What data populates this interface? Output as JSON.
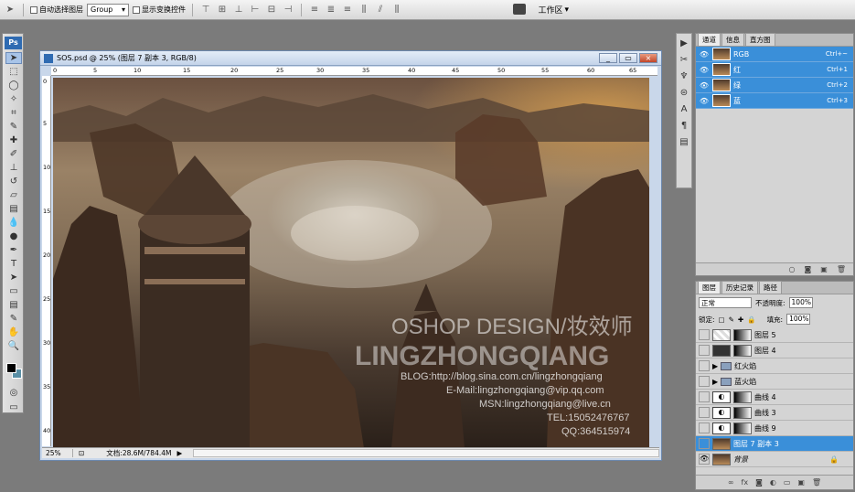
{
  "options_bar": {
    "auto_select_label": "自动选择图层",
    "auto_select_value": "Group",
    "show_transform_label": "显示变换控件",
    "workspace_label": "工作区"
  },
  "toolbox": {
    "logo": "Ps"
  },
  "document": {
    "title": "SOS.psd @ 25% (图层 7 副本 3, RGB/8)",
    "zoom": "25%",
    "doc_info": "文档:28.6M/784.4M",
    "ruler_h": [
      "0",
      "5",
      "10",
      "15",
      "20",
      "25",
      "30",
      "35",
      "40",
      "45",
      "50",
      "55",
      "60",
      "65"
    ],
    "ruler_v": [
      "0",
      "5",
      "10",
      "15",
      "20",
      "25",
      "30",
      "35",
      "40"
    ],
    "watermark": {
      "line1": "OSHOP DESIGN/妆效师",
      "line2": "LINGZHONGQIANG",
      "line3": "BLOG:http://blog.sina.com.cn/lingzhongqiang",
      "line4": "E-Mail:lingzhongqiang@vip.qq.com",
      "line5": "MSN:lingzhongqiang@live.cn",
      "line6": "TEL:15052476767",
      "line7": "QQ:364515974"
    }
  },
  "channels_panel": {
    "tabs": [
      "通道",
      "信息",
      "直方图"
    ],
    "rows": [
      {
        "name": "RGB",
        "shortcut": "Ctrl+~"
      },
      {
        "name": "红",
        "shortcut": "Ctrl+1"
      },
      {
        "name": "绿",
        "shortcut": "Ctrl+2"
      },
      {
        "name": "蓝",
        "shortcut": "Ctrl+3"
      }
    ]
  },
  "layers_panel": {
    "tabs": [
      "图层",
      "历史记录",
      "路径"
    ],
    "blend_mode": "正常",
    "opacity_label": "不透明度:",
    "opacity": "100%",
    "lock_label": "锁定:",
    "fill_label": "填充:",
    "fill": "100%",
    "rows": [
      {
        "name": "图层 5"
      },
      {
        "name": "图层 4"
      },
      {
        "name": "红火焰"
      },
      {
        "name": "蓝火焰"
      },
      {
        "name": "曲线 4"
      },
      {
        "name": "曲线 3"
      },
      {
        "name": "曲线 9"
      },
      {
        "name": "图层 7 副本 3"
      },
      {
        "name": "背景"
      }
    ]
  },
  "colors": {
    "selection": "#3a8fd9",
    "foreground": "#000000",
    "background": "#5a8fa5"
  }
}
